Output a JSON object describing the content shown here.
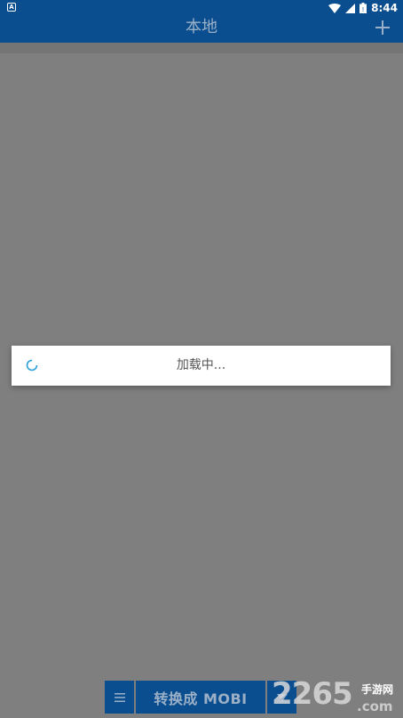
{
  "status_bar": {
    "time": "8:44",
    "icons": [
      "notification-a-icon",
      "wifi-icon",
      "signal-icon",
      "battery-icon"
    ]
  },
  "app_bar": {
    "title": "本地",
    "add_icon": "plus-icon"
  },
  "loading_dialog": {
    "message": "加载中...",
    "spinner_icon": "spinner-icon"
  },
  "bottom_toolbar": {
    "menu_icon": "menu-icon",
    "convert_label": "转换成 MOBI",
    "dropdown_icon": "triangle-down-icon"
  },
  "watermark": {
    "text": "2265.com 手游网"
  },
  "colors": {
    "primary": "#0b4e8f",
    "overlay": "#7f7f7f",
    "spinner": "#2a9fd6"
  }
}
